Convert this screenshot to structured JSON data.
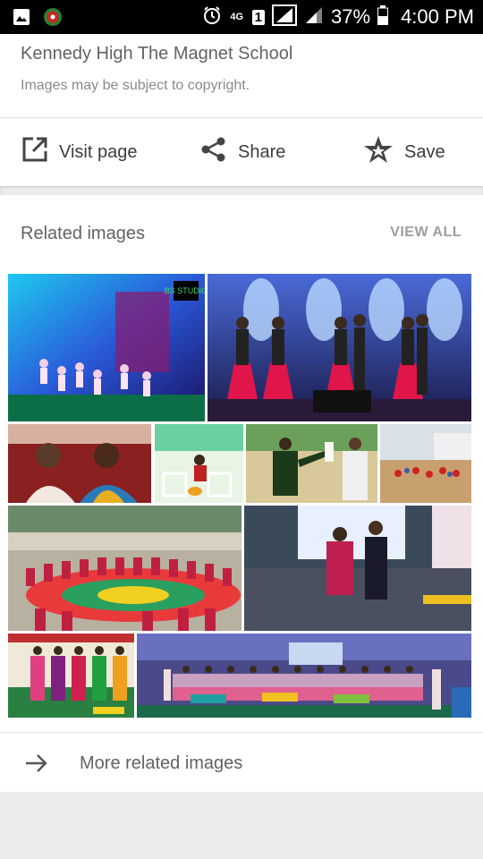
{
  "status_bar": {
    "network": "4G",
    "sim": "1",
    "battery": "37%",
    "time": "4:00 PM"
  },
  "source": {
    "title": "Kennedy High The Magnet School",
    "subtitle": "Images may be subject to copyright."
  },
  "actions": {
    "visit_label": "Visit page",
    "share_label": "Share",
    "save_label": "Save"
  },
  "related": {
    "heading": "Related images",
    "view_all": "VIEW ALL",
    "more_label": "More related images",
    "watermark": "BS STUDIO"
  },
  "icons": [
    "image-icon",
    "app-badge-icon",
    "alarm-icon",
    "signal-icon",
    "battery-icon",
    "open-in-new-icon",
    "share-icon",
    "star-icon",
    "arrow-right-icon"
  ]
}
